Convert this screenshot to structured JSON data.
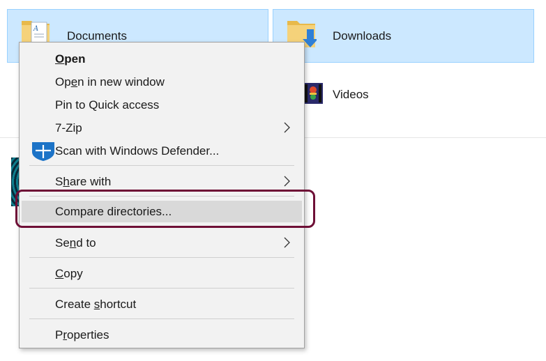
{
  "tiles": [
    {
      "label": "Documents",
      "selected": true
    },
    {
      "label": "Downloads",
      "selected": true
    },
    {
      "label": "Videos",
      "selected": false
    }
  ],
  "menu": {
    "items": [
      {
        "pre": "",
        "acc": "O",
        "post": "pen",
        "bold": true
      },
      {
        "pre": "Op",
        "acc": "e",
        "post": "n in new window"
      },
      {
        "pre": "Pin to Quick access",
        "acc": "",
        "post": ""
      },
      {
        "pre": "7-Zip",
        "acc": "",
        "post": "",
        "submenu": true
      },
      {
        "pre": "Scan with Windows Defender...",
        "acc": "",
        "post": "",
        "icon": "windows-defender-shield-icon"
      },
      {
        "pre": "S",
        "acc": "h",
        "post": "are with",
        "submenu": true
      },
      {
        "pre": "Compare directories...",
        "acc": "",
        "post": "",
        "highlighted": true
      },
      {
        "pre": "Se",
        "acc": "n",
        "post": "d to",
        "submenu": true
      },
      {
        "pre": "",
        "acc": "C",
        "post": "opy"
      },
      {
        "pre": "Create ",
        "acc": "s",
        "post": "hortcut"
      },
      {
        "pre": "P",
        "acc": "r",
        "post": "operties"
      }
    ]
  },
  "colors": {
    "selection_bg": "#cce8ff",
    "highlight_border": "#6e0f36",
    "menu_bg": "#f2f2f2"
  }
}
